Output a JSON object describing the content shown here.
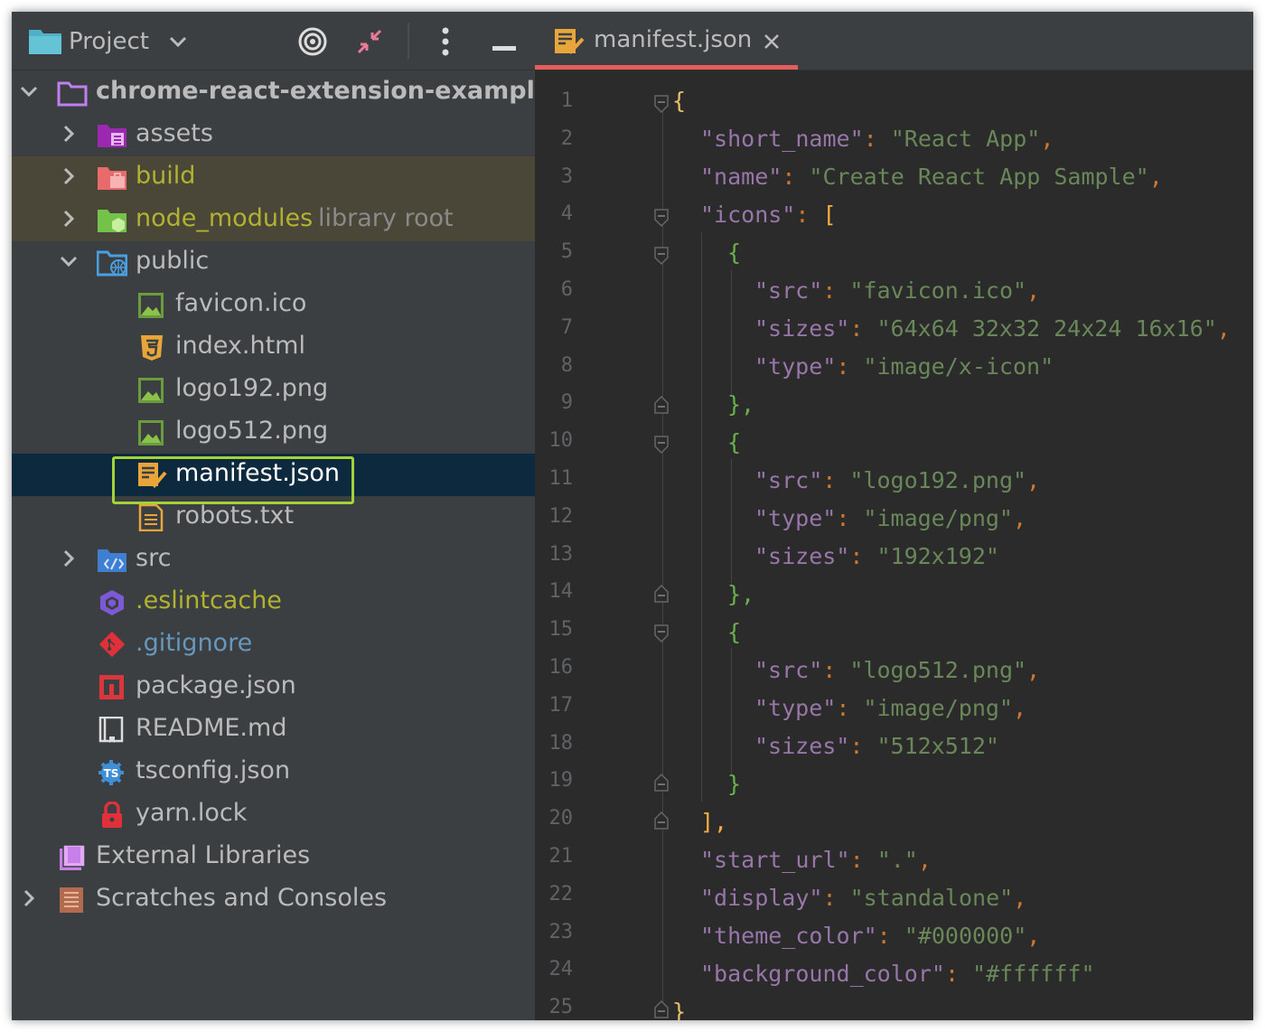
{
  "project_panel": {
    "title": "Project",
    "tree": [
      {
        "label": "chrome-react-extension-example",
        "icon": "folder-icon"
      },
      {
        "label": "assets",
        "icon": "resources-folder-icon"
      },
      {
        "label": "build",
        "icon": "excluded-folder-icon"
      },
      {
        "label": "node_modules",
        "suffix": "library root",
        "icon": "library-folder-icon"
      },
      {
        "label": "public",
        "icon": "web-folder-icon"
      },
      {
        "label": "favicon.ico",
        "icon": "image-file-icon"
      },
      {
        "label": "index.html",
        "icon": "html5-icon"
      },
      {
        "label": "logo192.png",
        "icon": "image-file-icon"
      },
      {
        "label": "logo512.png",
        "icon": "image-file-icon"
      },
      {
        "label": "manifest.json",
        "icon": "manifest-icon"
      },
      {
        "label": "robots.txt",
        "icon": "text-file-icon"
      },
      {
        "label": "src",
        "icon": "source-folder-icon"
      },
      {
        "label": ".eslintcache",
        "icon": "eslint-icon"
      },
      {
        "label": ".gitignore",
        "icon": "git-icon"
      },
      {
        "label": "package.json",
        "icon": "npm-icon"
      },
      {
        "label": "README.md",
        "icon": "readme-icon"
      },
      {
        "label": "tsconfig.json",
        "icon": "typescript-config-icon"
      },
      {
        "label": "yarn.lock",
        "icon": "lock-icon"
      },
      {
        "label": "External Libraries",
        "icon": "library-icon"
      },
      {
        "label": "Scratches and Consoles",
        "icon": "scratches-icon"
      }
    ]
  },
  "editor": {
    "tab_label": "manifest.json",
    "line_numbers": [
      "1",
      "2",
      "3",
      "4",
      "5",
      "6",
      "7",
      "8",
      "9",
      "10",
      "11",
      "12",
      "13",
      "14",
      "15",
      "16",
      "17",
      "18",
      "19",
      "20",
      "21",
      "22",
      "23",
      "24",
      "25"
    ],
    "code": {
      "keys": {
        "short_name": "\"short_name\"",
        "name": "\"name\"",
        "icons": "\"icons\"",
        "src": "\"src\"",
        "sizes": "\"sizes\"",
        "type": "\"type\"",
        "start_url": "\"start_url\"",
        "display": "\"display\"",
        "theme_color": "\"theme_color\"",
        "background_color": "\"background_color\""
      },
      "values": {
        "short_name": "\"React App\"",
        "name": "\"Create React App Sample\"",
        "src1": "\"favicon.ico\"",
        "sizes1": "\"64x64 32x32 24x24 16x16\"",
        "type1": "\"image/x-icon\"",
        "src2": "\"logo192.png\"",
        "type2": "\"image/png\"",
        "sizes2": "\"192x192\"",
        "src3": "\"logo512.png\"",
        "type3": "\"image/png\"",
        "sizes3": "\"512x512\"",
        "start_url": "\".\"",
        "display": "\"standalone\"",
        "theme_color": "\"#000000\"",
        "background_color": "\"#ffffff\""
      },
      "punct": {
        "open_brace": "{",
        "close_brace": "}",
        "open_bracket": "[",
        "close_bracket": "]",
        "colon": ": ",
        "comma": ",",
        "close_brace_comma": "},",
        "close_bracket_comma": "],"
      }
    }
  },
  "colors": {
    "panel_bg": "#3c3f41",
    "editor_bg": "#2b2b2b",
    "selection": "#0d293e",
    "excluded_bg": "#4a4739",
    "json_key": "#9876aa",
    "json_string": "#6a8759",
    "punctuation": "#cc7832",
    "tab_accent": "#e55c5c",
    "highlight_box": "#a5d236"
  }
}
